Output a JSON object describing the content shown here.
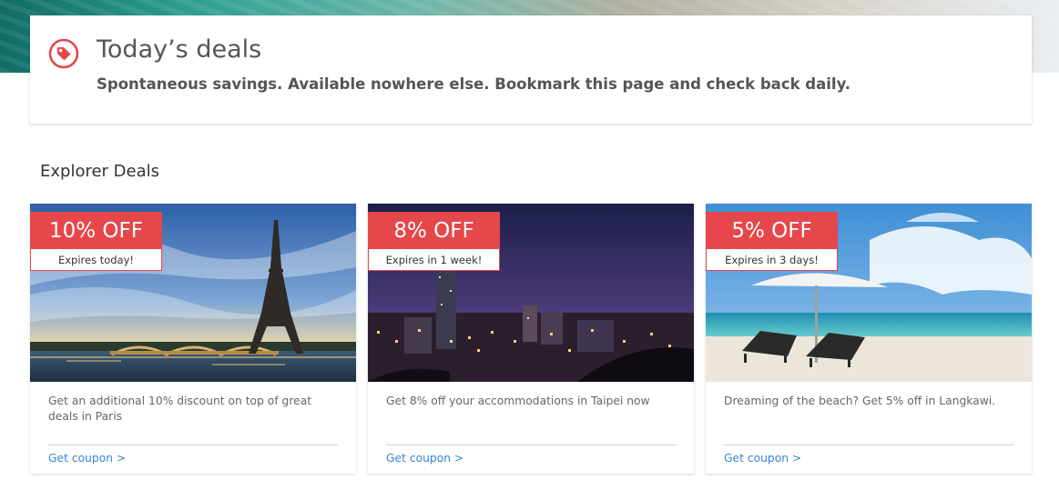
{
  "header": {
    "title": "Today’s deals",
    "subtitle": "Spontaneous savings. Available nowhere else. Bookmark this page and check back daily.",
    "icon": "price-tag-icon",
    "accent": "#e5474b"
  },
  "section": {
    "title": "Explorer Deals"
  },
  "deals": [
    {
      "discount": "10% OFF",
      "expiry": "Expires today!",
      "description": "Get an additional 10% discount on top of great deals in Paris",
      "link": "Get coupon >",
      "image": "eiffel-tower-paris"
    },
    {
      "discount": "8% OFF",
      "expiry": "Expires in 1 week!",
      "description": "Get 8% off your accommodations in Taipei now",
      "link": "Get coupon >",
      "image": "taipei-night-skyline"
    },
    {
      "discount": "5% OFF",
      "expiry": "Expires in 3 days!",
      "description": "Dreaming of the beach? Get 5% off in Langkawi.",
      "link": "Get coupon >",
      "image": "beach-umbrella-loungers"
    }
  ],
  "colors": {
    "badge": "#e5474b",
    "link": "#3b82d9",
    "text": "#555555"
  }
}
